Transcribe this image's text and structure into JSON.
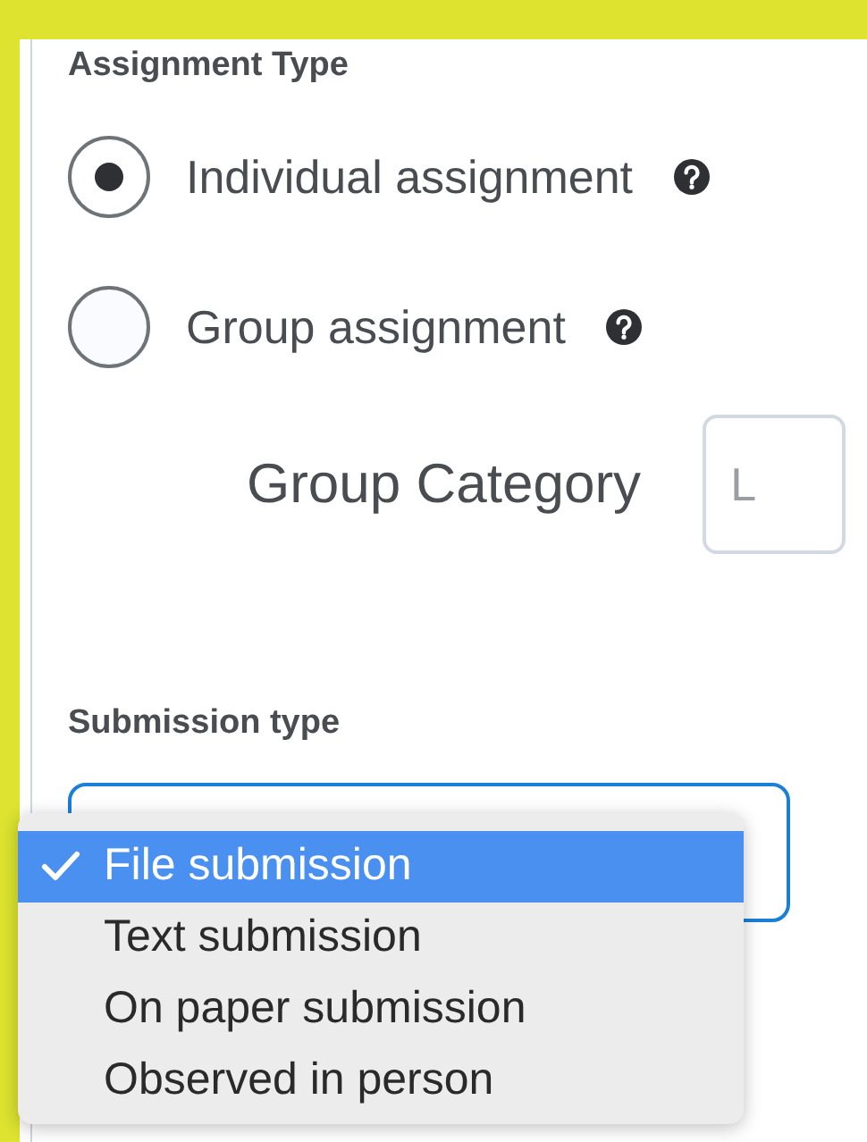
{
  "assignment_type": {
    "label": "Assignment Type",
    "options": [
      {
        "label": "Individual assignment",
        "selected": true
      },
      {
        "label": "Group assignment",
        "selected": false
      }
    ]
  },
  "group_category": {
    "label": "Group Category",
    "value": "L"
  },
  "submission_type": {
    "label": "Submission type",
    "menu": [
      {
        "label": "File submission",
        "selected": true
      },
      {
        "label": "Text submission",
        "selected": false
      },
      {
        "label": "On paper submission",
        "selected": false
      },
      {
        "label": "Observed in person",
        "selected": false
      }
    ]
  }
}
